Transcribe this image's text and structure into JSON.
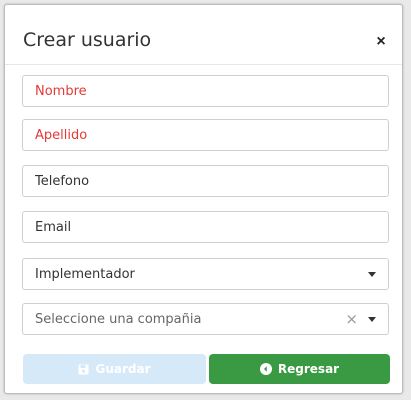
{
  "dialog": {
    "title": "Crear usuario",
    "close_label": "×"
  },
  "form": {
    "nombre": {
      "placeholder": "Nombre",
      "color": "#e53935"
    },
    "apellido": {
      "placeholder": "Apellido",
      "color": "#e53935"
    },
    "telefono": {
      "placeholder": "Telefono"
    },
    "email": {
      "placeholder": "Email"
    },
    "rol": {
      "selected": "Implementador",
      "icon": "chevron-down-icon"
    },
    "compania": {
      "placeholder": "Seleccione una compañia",
      "clear_icon": "×",
      "icon": "chevron-down-icon"
    }
  },
  "buttons": {
    "save": {
      "label": "Guardar",
      "icon": "save-icon",
      "color": "#d6e9f9"
    },
    "back": {
      "label": "Regresar",
      "icon": "back-circle-icon",
      "color": "#3a9a43"
    }
  }
}
